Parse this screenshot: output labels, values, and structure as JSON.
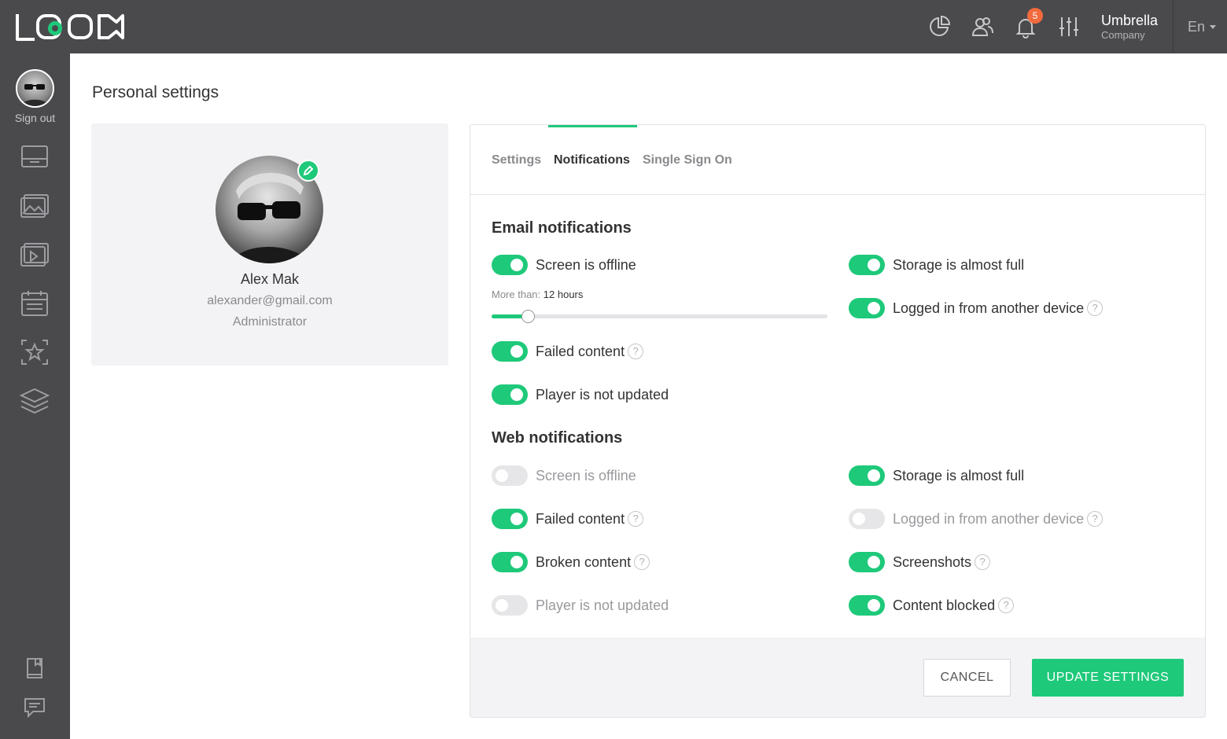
{
  "app": {
    "logo_alt": "LOOK"
  },
  "header": {
    "notifications_count": "5",
    "company_name": "Umbrella",
    "company_sub": "Company",
    "language": "En",
    "icons": [
      "analytics-icon",
      "users-icon",
      "bell-icon",
      "sliders-icon"
    ]
  },
  "sidebar": {
    "sign_out": "Sign out",
    "items": [
      "screens-icon",
      "images-icon",
      "playlists-icon",
      "schedule-icon",
      "featured-icon",
      "layers-icon"
    ],
    "bottom_items": [
      "book-icon",
      "chat-icon"
    ]
  },
  "page": {
    "title": "Personal settings"
  },
  "profile": {
    "name": "Alex Mak",
    "email": "alexander@gmail.com",
    "role": "Administrator"
  },
  "tabs": [
    {
      "label": "Settings",
      "active": false
    },
    {
      "label": "Notifications",
      "active": true
    },
    {
      "label": "Single Sign On",
      "active": false
    }
  ],
  "email_notifications": {
    "title": "Email notifications",
    "more_than_label": "More than:",
    "more_than_value": "12 hours",
    "slider_fraction": 0.11,
    "items": [
      {
        "label": "Screen is offline",
        "on": true,
        "help": false
      },
      {
        "label": "Storage is almost full",
        "on": true,
        "help": false
      },
      {
        "label": "Logged in from another device",
        "on": true,
        "help": true
      },
      {
        "label": "Failed content",
        "on": true,
        "help": true
      },
      {
        "label": "Player is not updated",
        "on": true,
        "help": false
      }
    ]
  },
  "web_notifications": {
    "title": "Web notifications",
    "items": [
      {
        "label": "Screen is offline",
        "on": false,
        "help": false
      },
      {
        "label": "Storage is almost full",
        "on": true,
        "help": false
      },
      {
        "label": "Failed content",
        "on": true,
        "help": true
      },
      {
        "label": "Logged in from another device",
        "on": false,
        "help": true
      },
      {
        "label": "Broken content",
        "on": true,
        "help": true
      },
      {
        "label": "Screenshots",
        "on": true,
        "help": true
      },
      {
        "label": "Player is not updated",
        "on": false,
        "help": false
      },
      {
        "label": "Content blocked",
        "on": true,
        "help": true
      }
    ]
  },
  "help_glyph": "?",
  "footer": {
    "cancel_label": "CANCEL",
    "update_label": "UPDATE SETTINGS"
  },
  "colors": {
    "accent": "#1ec97a",
    "chrome": "#4a4a4d",
    "badge": "#f26a3d"
  }
}
